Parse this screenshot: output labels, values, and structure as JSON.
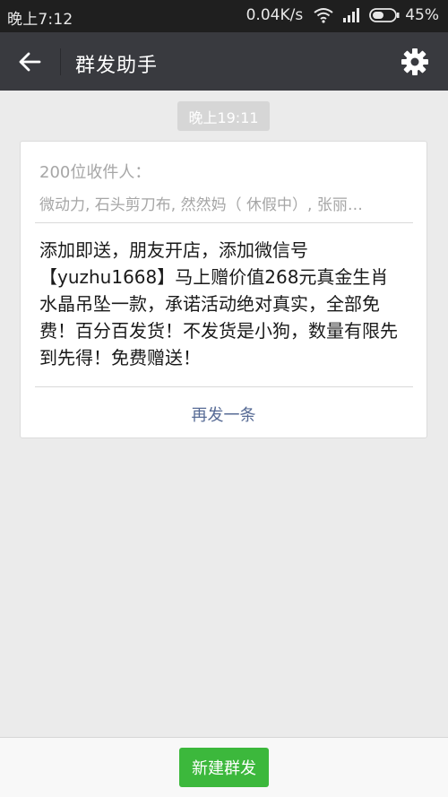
{
  "status_bar": {
    "time": "晚上7:12",
    "net_speed": "0.04K/s",
    "battery": "45%",
    "icons": [
      "wifi-icon",
      "signal-icon",
      "battery-icon"
    ]
  },
  "header": {
    "title": "群发助手",
    "back_icon": "back-arrow-icon",
    "settings_icon": "gear-icon"
  },
  "timestamp": "晚上19:11",
  "broadcast": {
    "recipient_count": "200位收件人：",
    "recipient_names": "微动力, 石头剪刀布, 然然妈（ 休假中）, 张丽…",
    "message_text": "添加即送，朋友开店，添加微信号【yuzhu1668】马上赠价值268元真金生肖水晶吊坠一款，承诺活动绝对真实，全部免费！百分百发货！不发货是小狗，数量有限先到先得！免费赠送！",
    "resend_label": "再发一条"
  },
  "footer": {
    "new_broadcast_label": "新建群发"
  },
  "colors": {
    "status_bar_bg": "#1f1f1f",
    "app_bar_bg": "#393a3f",
    "page_bg": "#ebebeb",
    "link": "#576b95",
    "primary_button": "#3cb83c"
  }
}
